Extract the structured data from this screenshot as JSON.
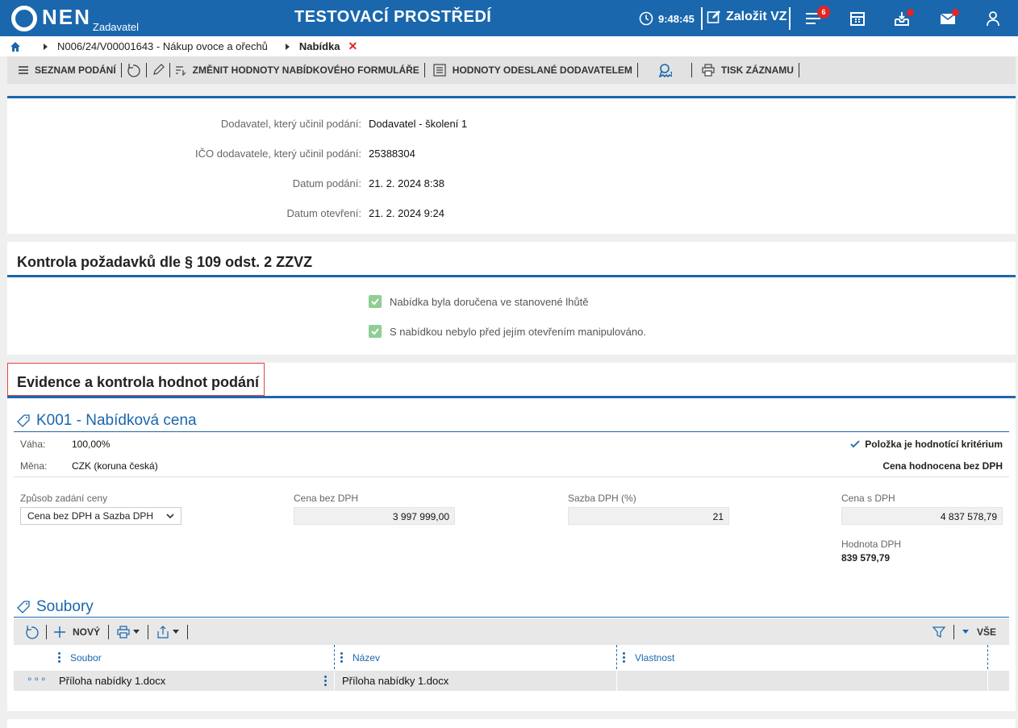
{
  "header": {
    "logo_text": "NEN",
    "logo_sub": "Zadavatel",
    "environment": "TESTOVACÍ PROSTŘEDÍ",
    "time": "9:48:45",
    "create_label": "Založit VZ",
    "notification_count": "6"
  },
  "breadcrumb": {
    "item1": "N006/24/V00001643 - Nákup ovoce a ořechů",
    "item2": "Nabídka",
    "close": "✕"
  },
  "toolbar": {
    "list": "SEZNAM PODÁNÍ",
    "change_values": "ZMĚNIT HODNOTY NABÍDKOVÉHO FORMULÁŘE",
    "sent_values": "HODNOTY ODESLANÉ DODAVATELEM",
    "print": "TISK ZÁZNAMU"
  },
  "info": {
    "supplier_label": "Dodavatel, který učinil podání:",
    "supplier_value": "Dodavatel - školení 1",
    "ico_label": "IČO dodavatele, který učinil podání:",
    "ico_value": "25388304",
    "submitted_label": "Datum podání:",
    "submitted_value": "21. 2. 2024 8:38",
    "opened_label": "Datum otevření:",
    "opened_value": "21. 2. 2024 9:24"
  },
  "control": {
    "title": "Kontrola požadavků dle § 109 odst. 2 ZZVZ",
    "check1": "Nabídka byla doručena ve stanovené lhůtě",
    "check2": "S nabídkou nebylo před jejím otevřením manipulováno."
  },
  "evidence": {
    "title": "Evidence a kontrola hodnot podání",
    "criterion_title": "K001 - Nabídková cena",
    "weight_label": "Váha:",
    "weight_value": "100,00%",
    "currency_label": "Měna:",
    "currency_value": "CZK (koruna česká)",
    "is_criterion": "Položka je hodnotící kritérium",
    "price_without_vat_note": "Cena hodnocena bez DPH",
    "mode_label": "Způsob zadání ceny",
    "mode_value": "Cena bez DPH a Sazba DPH",
    "price_label": "Cena bez DPH",
    "price_value": "3 997 999,00",
    "rate_label": "Sazba DPH (%)",
    "rate_value": "21",
    "price_vat_label": "Cena s DPH",
    "price_vat_value": "4 837 578,79",
    "vat_label": "Hodnota DPH",
    "vat_value": "839 579,79"
  },
  "files": {
    "title": "Soubory",
    "new_label": "NOVÝ",
    "all_label": "VŠE",
    "columns": [
      "Soubor",
      "Název",
      "Vlastnost"
    ],
    "rows": [
      {
        "file": "Příloha nabídky 1.docx",
        "name": "Příloha nabídky 1.docx",
        "property": ""
      }
    ]
  }
}
